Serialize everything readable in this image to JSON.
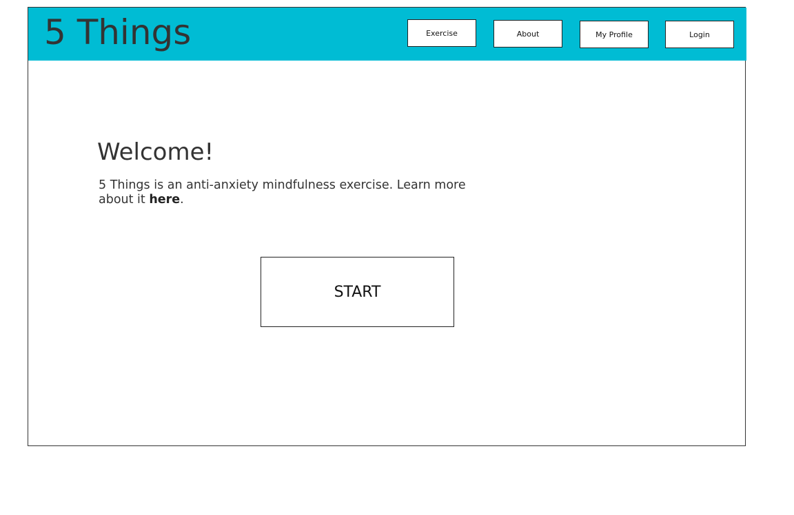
{
  "header": {
    "logo": "5 Things",
    "background_color": "#00bcd4"
  },
  "nav": {
    "exercise": "Exercise",
    "about": "About",
    "my_profile": "My Profile",
    "login": "Login"
  },
  "main": {
    "welcome_title": "Welcome!",
    "intro_text": "5 Things is an anti-anxiety mindfulness exercise. Learn more about it ",
    "intro_link": "here",
    "intro_end": ".",
    "start_button": "START"
  }
}
